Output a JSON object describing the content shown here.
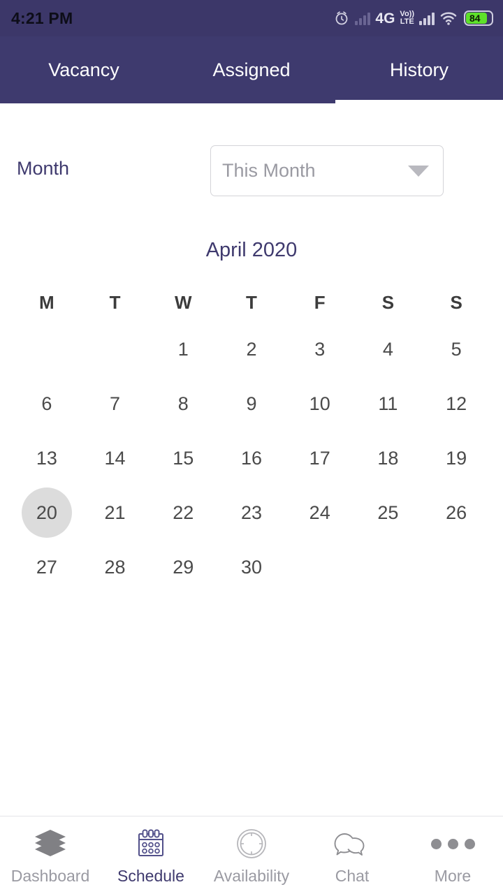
{
  "status_bar": {
    "time": "4:21 PM",
    "network_label": "4G",
    "volte_top": "Vo))",
    "volte_bottom": "LTE",
    "battery_level": "84",
    "icons": [
      "alarm-icon",
      "signal-bars-dim-icon",
      "4g-icon",
      "volte-icon",
      "signal-bars-icon",
      "wifi-icon",
      "battery-icon"
    ]
  },
  "tabs": [
    {
      "label": "Vacancy",
      "active": false
    },
    {
      "label": "Assigned",
      "active": false
    },
    {
      "label": "History",
      "active": true
    }
  ],
  "filter": {
    "label": "Month",
    "dropdown_value": "This Month",
    "dropdown_icon": "chevron-down-icon"
  },
  "calendar": {
    "title": "April 2020",
    "weekdays": [
      "M",
      "T",
      "W",
      "T",
      "F",
      "S",
      "S"
    ],
    "leading_blanks": 2,
    "days": [
      1,
      2,
      3,
      4,
      5,
      6,
      7,
      8,
      9,
      10,
      11,
      12,
      13,
      14,
      15,
      16,
      17,
      18,
      19,
      20,
      21,
      22,
      23,
      24,
      25,
      26,
      27,
      28,
      29,
      30
    ],
    "selected_day": 20
  },
  "bottom_nav": [
    {
      "label": "Dashboard",
      "icon": "layers-icon",
      "active": false
    },
    {
      "label": "Schedule",
      "icon": "calendar-icon",
      "active": true
    },
    {
      "label": "Availability",
      "icon": "clock-ring-icon",
      "active": false
    },
    {
      "label": "Chat",
      "icon": "chat-bubbles-icon",
      "active": false
    },
    {
      "label": "More",
      "icon": "three-dots-icon",
      "active": false
    }
  ],
  "colors": {
    "header_purple": "#3e3a6e",
    "status_purple": "#3c3769",
    "accent": "#3f3a6e",
    "muted_text": "#9a9aa2",
    "selected_day_bg": "#dcdcdc",
    "battery_green": "#5ee12a"
  }
}
